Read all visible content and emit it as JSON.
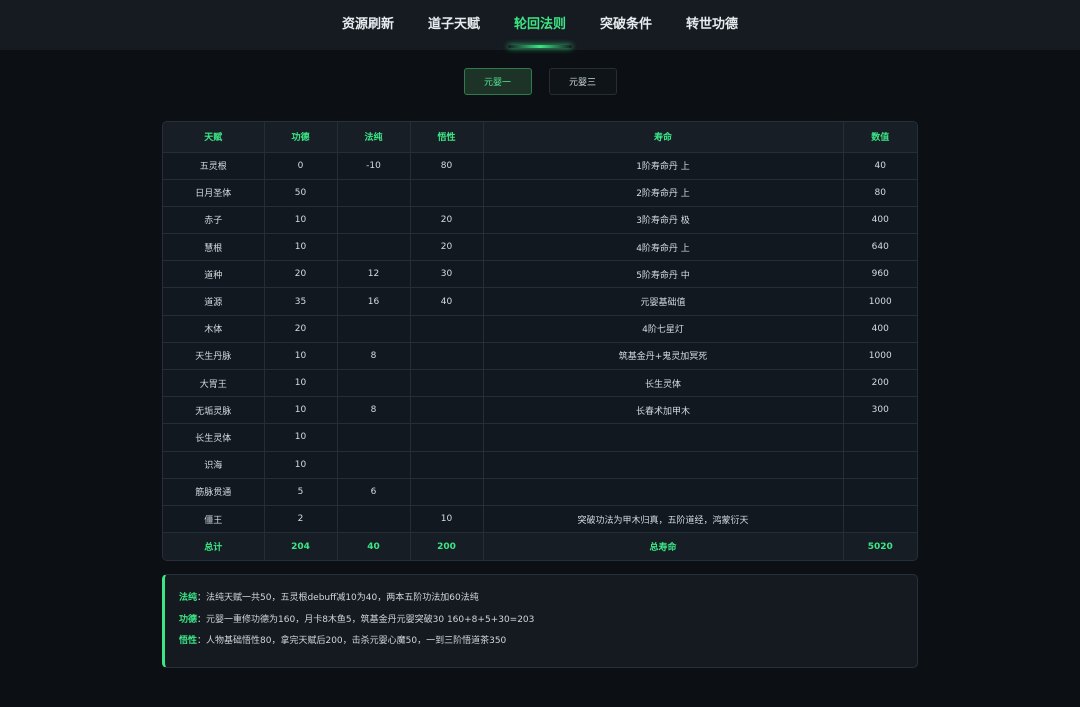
{
  "nav": {
    "items": [
      "资源刷新",
      "道子天赋",
      "轮回法则",
      "突破条件",
      "转世功德"
    ],
    "active_index": 2
  },
  "subtabs": {
    "items": [
      "元婴一",
      "元婴三"
    ],
    "active_index": 0
  },
  "table": {
    "headers": [
      "天赋",
      "功德",
      "法纯",
      "悟性",
      "寿命",
      "数值"
    ],
    "rows": [
      [
        "五灵根",
        "0",
        "-10",
        "80",
        "1阶寿命丹 上",
        "40"
      ],
      [
        "日月圣体",
        "50",
        "",
        "",
        "2阶寿命丹 上",
        "80"
      ],
      [
        "赤子",
        "10",
        "",
        "20",
        "3阶寿命丹 极",
        "400"
      ],
      [
        "慧根",
        "10",
        "",
        "20",
        "4阶寿命丹 上",
        "640"
      ],
      [
        "道种",
        "20",
        "12",
        "30",
        "5阶寿命丹 中",
        "960"
      ],
      [
        "道源",
        "35",
        "16",
        "40",
        "元婴基础值",
        "1000"
      ],
      [
        "木体",
        "20",
        "",
        "",
        "4阶七星灯",
        "400"
      ],
      [
        "天生丹脉",
        "10",
        "8",
        "",
        "筑基金丹+鬼灵加冥死",
        "1000"
      ],
      [
        "大胃王",
        "10",
        "",
        "",
        "长生灵体",
        "200"
      ],
      [
        "无垢灵脉",
        "10",
        "8",
        "",
        "长春术加甲木",
        "300"
      ],
      [
        "长生灵体",
        "10",
        "",
        "",
        "",
        ""
      ],
      [
        "识海",
        "10",
        "",
        "",
        "",
        ""
      ],
      [
        "筋脉贯通",
        "5",
        "6",
        "",
        "",
        ""
      ],
      [
        "僵王",
        "2",
        "",
        "10",
        "突破功法为甲木归真，五阶道经，鸿蒙衍天",
        ""
      ]
    ],
    "total_row": [
      "总计",
      "204",
      "40",
      "200",
      "总寿命",
      "5020"
    ]
  },
  "notes": [
    {
      "label": "法纯",
      "text": "：法纯天赋一共50，五灵根debuff减10为40，两本五阶功法加60法纯"
    },
    {
      "label": "功德",
      "text": "：元婴一重修功德为160，月卡8木鱼5，筑基金丹元婴突破30 160+8+5+30=203"
    },
    {
      "label": "悟性",
      "text": "：人物基础悟性80，拿完天赋后200，击杀元婴心魔50，一到三阶悟道茶350"
    }
  ],
  "colors": {
    "accent": "#3ce686",
    "background": "#0c1014",
    "panel": "#141a20"
  }
}
